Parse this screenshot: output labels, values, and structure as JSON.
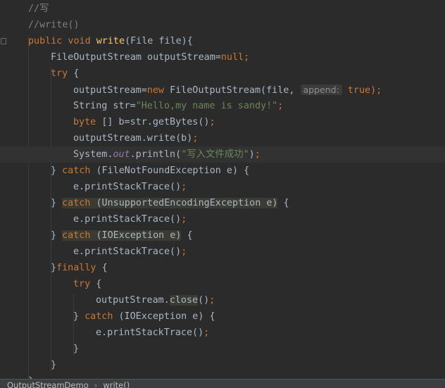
{
  "editor": {
    "lines": [
      {
        "indent": 1,
        "tokens": [
          {
            "t": "//写",
            "c": "c"
          }
        ]
      },
      {
        "indent": 1,
        "tokens": [
          {
            "t": "//write()",
            "c": "c"
          }
        ]
      },
      {
        "indent": 1,
        "tokens": [
          {
            "t": "public void ",
            "c": "k"
          },
          {
            "t": "write",
            "c": "f"
          },
          {
            "t": "(File file){",
            "c": "p"
          }
        ]
      },
      {
        "indent": 2,
        "tokens": [
          {
            "t": "FileOutputStream outputStream=",
            "c": "p"
          },
          {
            "t": "null",
            "c": "k"
          },
          {
            "t": ";",
            "c": "k"
          }
        ]
      },
      {
        "indent": 2,
        "tokens": [
          {
            "t": "try ",
            "c": "k"
          },
          {
            "t": "{",
            "c": "p"
          }
        ]
      },
      {
        "indent": 3,
        "tokens": [
          {
            "t": "outputStream=",
            "c": "p"
          },
          {
            "t": "new ",
            "c": "k"
          },
          {
            "t": "FileOutputStream(file, ",
            "c": "p"
          },
          {
            "t": "append:",
            "c": "hint"
          },
          {
            "t": " ",
            "c": "p"
          },
          {
            "t": "true",
            "c": "k"
          },
          {
            "t": ");",
            "c": "k"
          }
        ]
      },
      {
        "indent": 3,
        "tokens": [
          {
            "t": "String str=",
            "c": "p"
          },
          {
            "t": "\"Hello,my name is sandy!\"",
            "c": "s"
          },
          {
            "t": ";",
            "c": "k"
          }
        ]
      },
      {
        "indent": 3,
        "tokens": [
          {
            "t": "byte ",
            "c": "k"
          },
          {
            "t": "[] b=str.getBytes()",
            "c": "p"
          },
          {
            "t": ";",
            "c": "k"
          }
        ]
      },
      {
        "indent": 3,
        "tokens": [
          {
            "t": "outputStream.write(b)",
            "c": "p"
          },
          {
            "t": ";",
            "c": "k"
          }
        ]
      },
      {
        "indent": 3,
        "current": true,
        "tokens": [
          {
            "t": "System.",
            "c": "p"
          },
          {
            "t": "out",
            "c": "st"
          },
          {
            "t": ".println(",
            "c": "p"
          },
          {
            "t": "\"写入文件成功\"",
            "c": "s"
          },
          {
            "t": ")",
            "c": "p"
          },
          {
            "t": ";",
            "c": "k"
          }
        ]
      },
      {
        "indent": 2,
        "tokens": [
          {
            "t": "} ",
            "c": "p"
          },
          {
            "t": "catch ",
            "c": "k"
          },
          {
            "t": "(FileNotFoundException e) {",
            "c": "p"
          }
        ]
      },
      {
        "indent": 3,
        "tokens": [
          {
            "t": "e.printStackTrace()",
            "c": "p"
          },
          {
            "t": ";",
            "c": "k"
          }
        ]
      },
      {
        "indent": 2,
        "tokens": [
          {
            "t": "} ",
            "c": "p"
          },
          {
            "t": "catch",
            "c": "ks"
          },
          {
            "t": " (UnsupportedEncodingException e)",
            "c": "h"
          },
          {
            "t": " {",
            "c": "p"
          }
        ]
      },
      {
        "indent": 3,
        "tokens": [
          {
            "t": "e.printStackTrace()",
            "c": "p"
          },
          {
            "t": ";",
            "c": "k"
          }
        ]
      },
      {
        "indent": 2,
        "tokens": [
          {
            "t": "} ",
            "c": "p"
          },
          {
            "t": "catch",
            "c": "ks"
          },
          {
            "t": " (IOException e)",
            "c": "h"
          },
          {
            "t": " {",
            "c": "p"
          }
        ]
      },
      {
        "indent": 3,
        "tokens": [
          {
            "t": "e.printStackTrace()",
            "c": "p"
          },
          {
            "t": ";",
            "c": "k"
          }
        ]
      },
      {
        "indent": 2,
        "tokens": [
          {
            "t": "}",
            "c": "p"
          },
          {
            "t": "finally ",
            "c": "k"
          },
          {
            "t": "{",
            "c": "p"
          }
        ]
      },
      {
        "indent": 3,
        "tokens": [
          {
            "t": "try ",
            "c": "k"
          },
          {
            "t": "{",
            "c": "p"
          }
        ]
      },
      {
        "indent": 4,
        "tokens": [
          {
            "t": "outputStream.",
            "c": "p"
          },
          {
            "t": "close",
            "c": "h"
          },
          {
            "t": "()",
            "c": "p"
          },
          {
            "t": ";",
            "c": "k"
          }
        ]
      },
      {
        "indent": 3,
        "tokens": [
          {
            "t": "} ",
            "c": "p"
          },
          {
            "t": "catch ",
            "c": "k"
          },
          {
            "t": "(IOException e) {",
            "c": "p"
          }
        ]
      },
      {
        "indent": 4,
        "tokens": [
          {
            "t": "e.printStackTrace()",
            "c": "p"
          },
          {
            "t": ";",
            "c": "k"
          }
        ]
      },
      {
        "indent": 3,
        "tokens": [
          {
            "t": "}",
            "c": "p"
          }
        ]
      },
      {
        "indent": 2,
        "tokens": [
          {
            "t": "}",
            "c": "p"
          }
        ]
      },
      {
        "indent": 1,
        "tokens": [
          {
            "t": "}",
            "c": "p"
          }
        ]
      }
    ]
  },
  "breadcrumb": {
    "class_name": "OutputStreamDemo",
    "separator": "›",
    "method": "write()"
  },
  "colors": {
    "background": "#2b2b2b",
    "keyword": "#cc7832",
    "method_declaration": "#ffc66d",
    "string": "#6a8759",
    "comment": "#808080",
    "static_field": "#9876aa",
    "plain": "#a9b7c6",
    "current_line": "#323232",
    "highlight": "#3b3b33"
  }
}
